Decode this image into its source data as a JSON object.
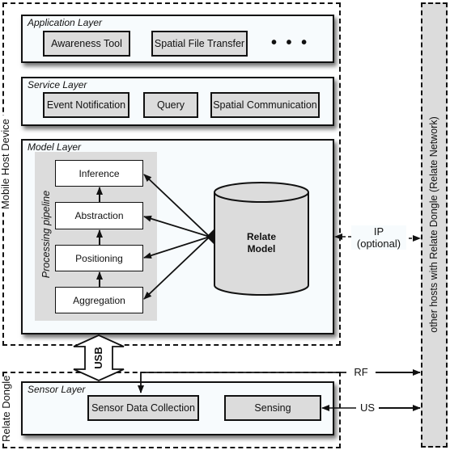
{
  "mobile_host_device": {
    "label": "Mobile Host Device",
    "application_layer": {
      "title": "Application Layer",
      "items": [
        "Awareness Tool",
        "Spatial File Transfer"
      ],
      "more": "• • •"
    },
    "service_layer": {
      "title": "Service Layer",
      "items": [
        "Event Notification",
        "Query",
        "Spatial Communication"
      ]
    },
    "model_layer": {
      "title": "Model Layer",
      "pipeline_label": "Processing pipeline",
      "pipeline_stages": [
        "Inference",
        "Abstraction",
        "Positioning",
        "Aggregation"
      ],
      "model_store": {
        "line1": "Relate",
        "line2": "Model"
      }
    }
  },
  "usb": {
    "label": "USB"
  },
  "relate_dongle": {
    "label": "Relate Dongle",
    "sensor_layer": {
      "title": "Sensor Layer",
      "items": [
        "Sensor Data Collection",
        "Sensing"
      ]
    }
  },
  "links": {
    "ip": {
      "line1": "IP",
      "line2": "(optional)"
    },
    "rf": "RF",
    "us": "US"
  },
  "other_hosts": {
    "label": "other hosts with Relate Dongle (Relate Network)"
  }
}
